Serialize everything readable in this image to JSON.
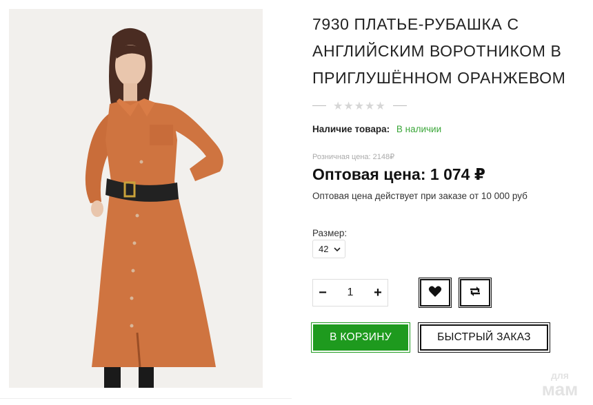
{
  "product": {
    "title": "7930 ПЛАТЬЕ-РУБАШКА С АНГЛИЙСКИМ ВОРОТНИКОМ В ПРИГЛУШЁННОМ ОРАНЖЕВОМ",
    "rating_stars": "★★★★★",
    "rating_value": 0,
    "stock_label": "Наличие товара:",
    "stock_value": "В наличии",
    "retail_price_label": "Розничная цена: 2148₽",
    "wholesale_price": "Оптовая цена: 1 074 ₽",
    "wholesale_note": "Оптовая цена действует при заказе от 10 000 руб",
    "size_label": "Размер:",
    "size_selected": "42",
    "quantity": "1"
  },
  "buttons": {
    "minus": "−",
    "plus": "+",
    "add_to_cart": "В КОРЗИНУ",
    "quick_order": "БЫСТРЫЙ ЗАКАЗ"
  },
  "icons": {
    "wishlist": "heart-icon",
    "compare": "compare-arrows-icon",
    "select_arrow": "chevron-down-icon"
  },
  "watermark": {
    "line1": "для",
    "line2": "мам"
  },
  "colors": {
    "accent_green": "#1e9a1e",
    "stock_green": "#3aa638",
    "dress_orange": "#cf7440"
  }
}
